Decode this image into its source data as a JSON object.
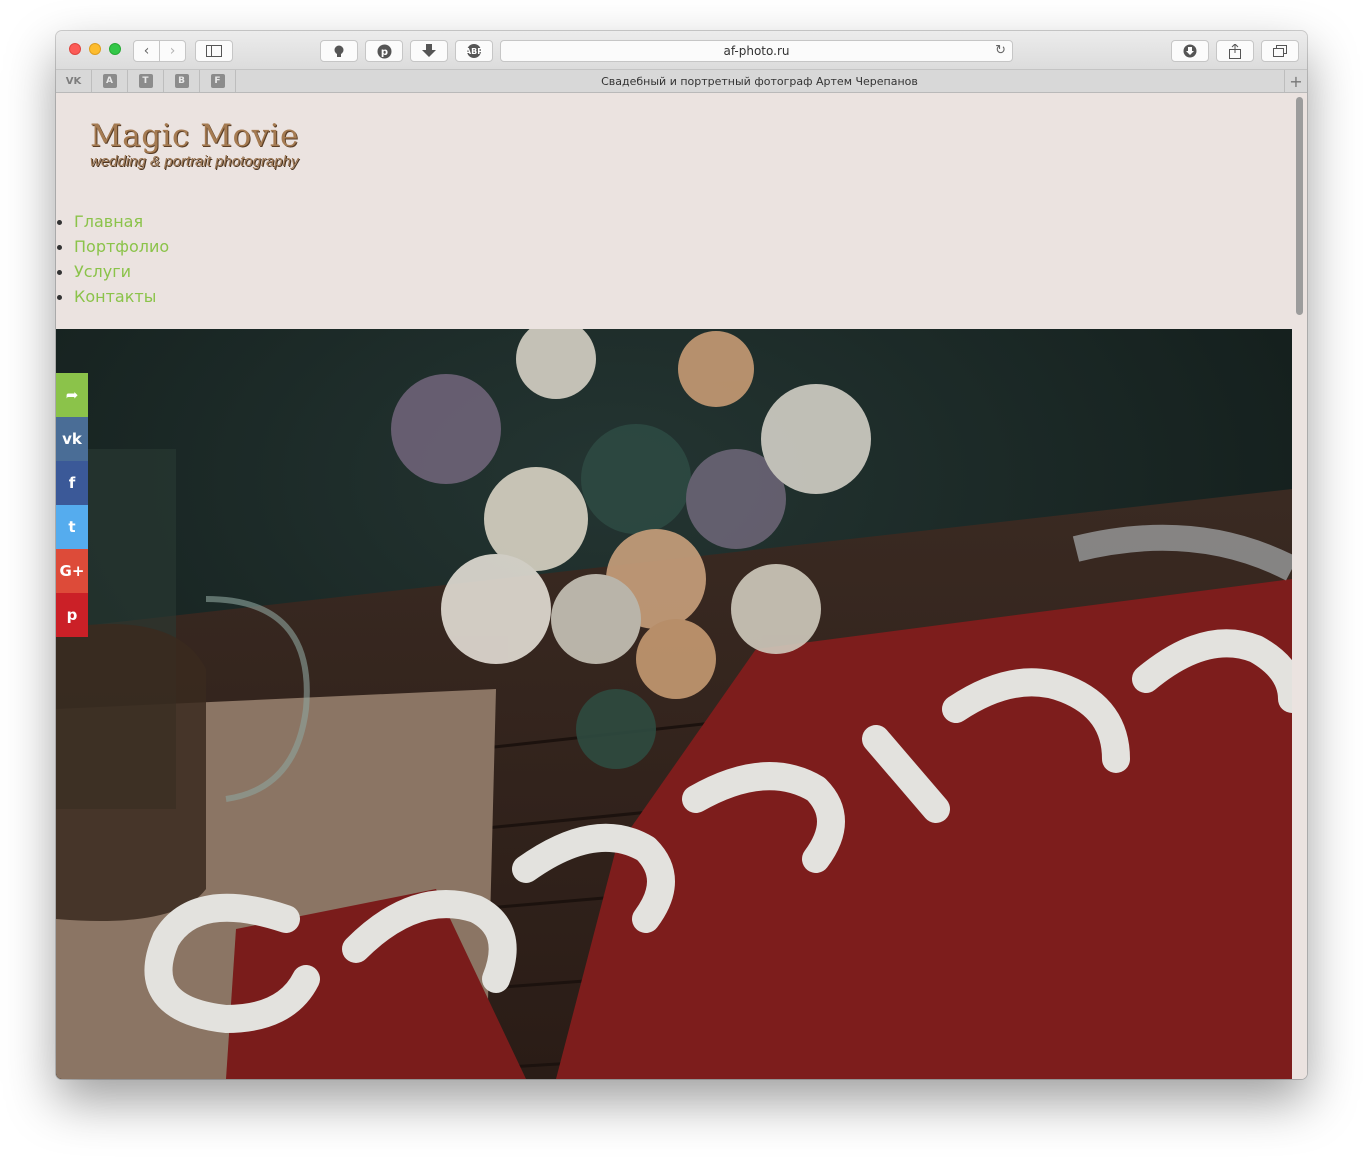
{
  "browser": {
    "url": "af-photo.ru",
    "tab_title": "Свадебный и портретный фотограф Артем Черепанов",
    "bookmarks": [
      "VK",
      "A",
      "T",
      "B",
      "F"
    ],
    "nav_back": "‹",
    "nav_forward": "›",
    "reload": "↻",
    "new_tab": "+",
    "abp": "ABP"
  },
  "site": {
    "logo_title": "Magic Movie",
    "logo_subtitle": "wedding & portrait photography"
  },
  "menu": [
    {
      "label": "Главная"
    },
    {
      "label": "Портфолио"
    },
    {
      "label": "Услуги"
    },
    {
      "label": "Контакты"
    }
  ],
  "share": [
    {
      "name": "share",
      "glyph": "➦",
      "color": "#8bc34a"
    },
    {
      "name": "vk",
      "glyph": "vk",
      "color": "#4a6d96"
    },
    {
      "name": "facebook",
      "glyph": "f",
      "color": "#3b5998"
    },
    {
      "name": "twitter",
      "glyph": "t",
      "color": "#55acee"
    },
    {
      "name": "google-plus",
      "glyph": "G+",
      "color": "#dd4b39"
    },
    {
      "name": "pinterest",
      "glyph": "p",
      "color": "#cb2027"
    }
  ],
  "colors": {
    "page_bg": "#ebe3e0",
    "menu_link": "#8bc34a",
    "logo": "#a57b52"
  }
}
